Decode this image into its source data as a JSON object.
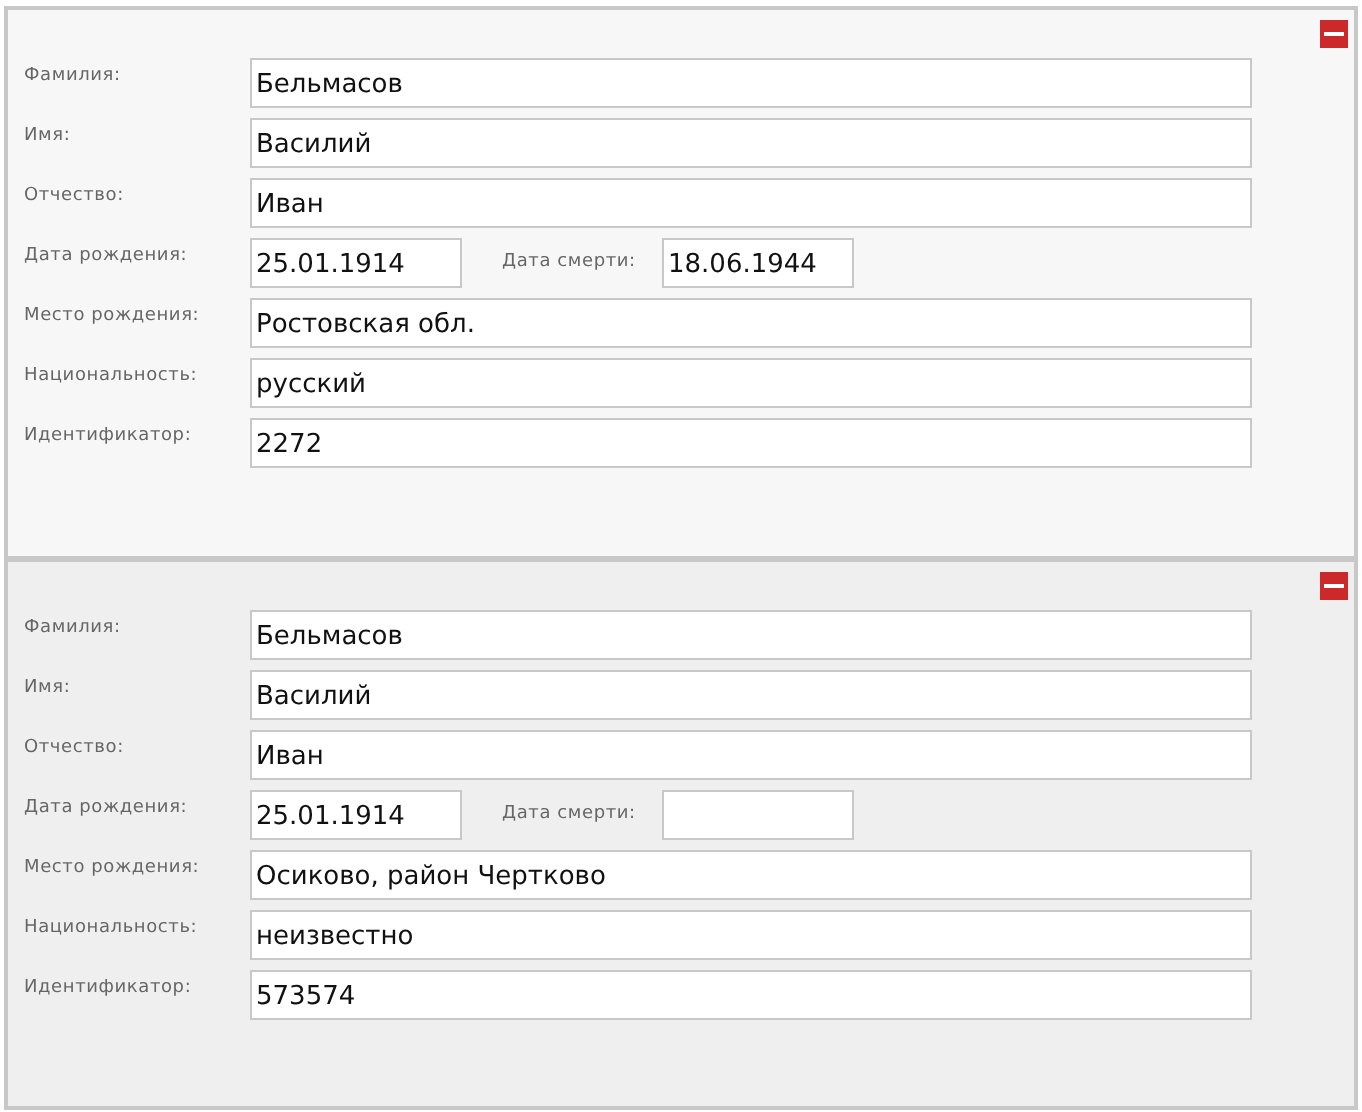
{
  "records": [
    {
      "rows": [
        {
          "kind": "text",
          "label": "Фамилия:",
          "value": "Бельмасов"
        },
        {
          "kind": "text",
          "label": "Имя:",
          "value": "Василий"
        },
        {
          "kind": "text",
          "label": "Отчество:",
          "value": "Иван"
        },
        {
          "kind": "dates",
          "label": "Дата рождения:",
          "value": "25.01.1914",
          "second_label": "Дата смерти:",
          "second_value": "18.06.1944"
        },
        {
          "kind": "text",
          "label": "Место рождения:",
          "value": "Ростовская обл."
        },
        {
          "kind": "text",
          "label": "Национальность:",
          "value": "русский"
        },
        {
          "kind": "text",
          "label": "Идентификатор:",
          "value": "2272"
        }
      ]
    },
    {
      "rows": [
        {
          "kind": "text",
          "label": "Фамилия:",
          "value": "Бельмасов"
        },
        {
          "kind": "text",
          "label": "Имя:",
          "value": "Василий"
        },
        {
          "kind": "text",
          "label": "Отчество:",
          "value": "Иван"
        },
        {
          "kind": "dates",
          "label": "Дата рождения:",
          "value": "25.01.1914",
          "second_label": "Дата смерти:"
        },
        {
          "kind": "text",
          "label": "Место рождения:",
          "value": "Осиково, район Чертково"
        },
        {
          "kind": "text",
          "label": "Национальность:",
          "value": "неизвестно"
        },
        {
          "kind": "text",
          "label": "Идентификатор:",
          "value": "573574"
        }
      ]
    }
  ]
}
